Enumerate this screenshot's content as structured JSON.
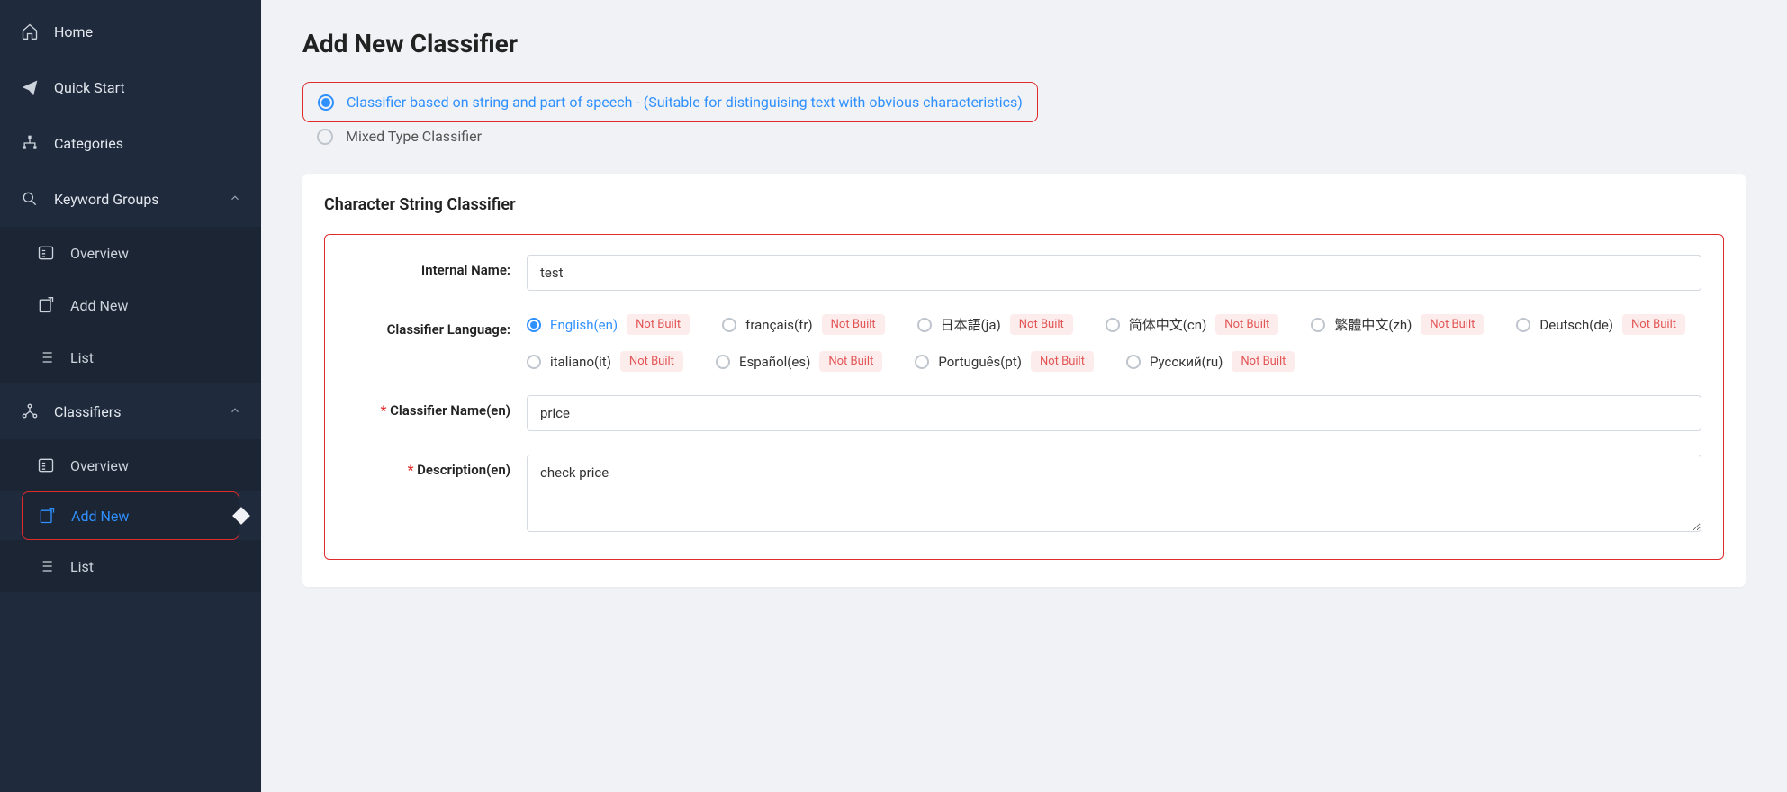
{
  "sidebar": {
    "home": "Home",
    "quick_start": "Quick Start",
    "categories": "Categories",
    "keyword_groups": "Keyword Groups",
    "kg_overview": "Overview",
    "kg_add_new": "Add New",
    "kg_list": "List",
    "classifiers": "Classifiers",
    "c_overview": "Overview",
    "c_add_new": "Add New",
    "c_list": "List"
  },
  "page": {
    "title": "Add New Classifier",
    "opt_string": "Classifier based on string and part of speech - (Suitable for distinguising text with obvious characteristics)",
    "opt_mixed": "Mixed Type Classifier"
  },
  "panel": {
    "title": "Character String Classifier",
    "labels": {
      "internal_name": "Internal Name:",
      "classifier_language": "Classifier Language:",
      "classifier_name": "Classifier Name(en)",
      "description": "Description(en)"
    },
    "values": {
      "internal_name": "test",
      "classifier_name": "price",
      "description": "check price"
    },
    "badge": "Not Built",
    "languages": [
      {
        "label": "English(en)",
        "selected": true
      },
      {
        "label": "français(fr)",
        "selected": false
      },
      {
        "label": "日本語(ja)",
        "selected": false
      },
      {
        "label": "简体中文(cn)",
        "selected": false
      },
      {
        "label": "繁體中文(zh)",
        "selected": false
      },
      {
        "label": "Deutsch(de)",
        "selected": false
      },
      {
        "label": "italiano(it)",
        "selected": false
      },
      {
        "label": "Español(es)",
        "selected": false
      },
      {
        "label": "Português(pt)",
        "selected": false
      },
      {
        "label": "Русский(ru)",
        "selected": false
      }
    ]
  }
}
